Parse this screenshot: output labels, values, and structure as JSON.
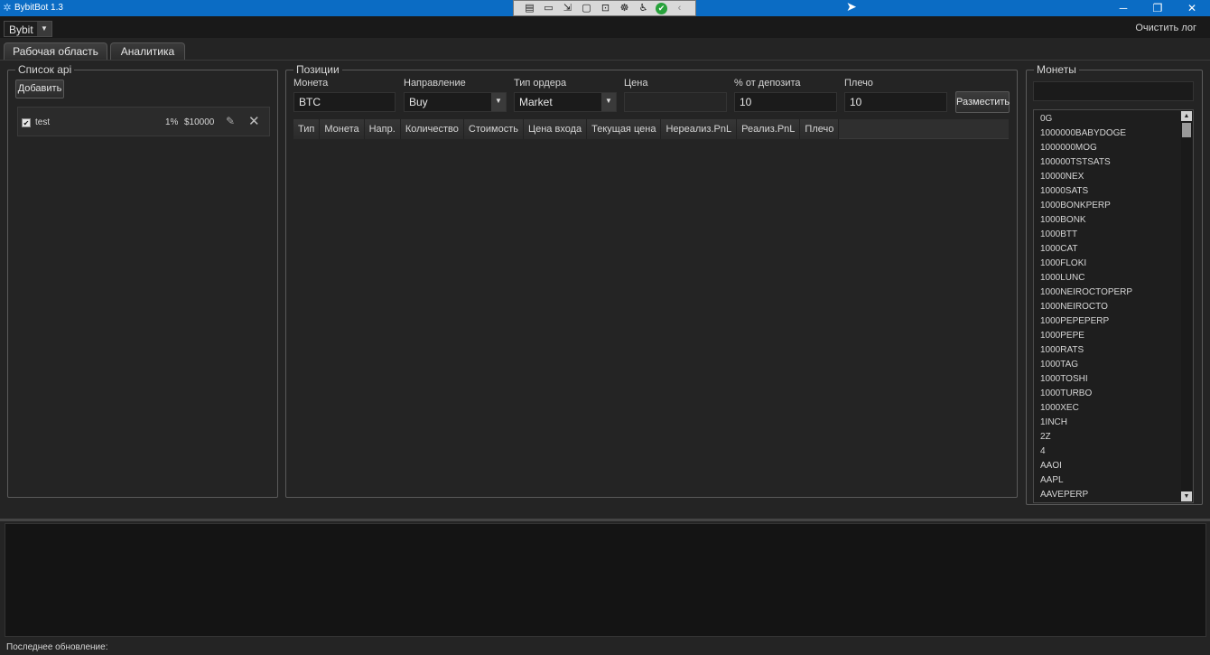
{
  "window": {
    "title": "BybitBot 1.3",
    "app_icon": "app-icon",
    "controls": {
      "minimize": "─",
      "maximize": "❐",
      "close": "✕"
    }
  },
  "recorder_toolbar": {
    "icons": [
      "select-icon",
      "video-icon",
      "pointer-icon",
      "frame-icon",
      "window-icon",
      "gamepad-icon",
      "accessibility-icon",
      "check-icon",
      "collapse-icon"
    ],
    "glyphs": [
      "▤",
      "▭",
      "⇲",
      "▢",
      "⊡",
      "☸",
      "♿",
      "✔",
      "‹"
    ]
  },
  "menubar": {
    "exchange": "Bybit",
    "clear_log": "Очистить лог"
  },
  "tabs": [
    {
      "label": "Рабочая область"
    },
    {
      "label": "Аналитика"
    }
  ],
  "api_panel": {
    "title": "Список api",
    "add_button": "Добавить",
    "items": [
      {
        "name": "test",
        "percent": "1%",
        "balance": "$10000",
        "checked": true
      }
    ]
  },
  "positions_panel": {
    "title": "Позиции",
    "fields": {
      "coin": {
        "label": "Монета",
        "value": "BTC"
      },
      "direction": {
        "label": "Направление",
        "value": "Buy"
      },
      "order_type": {
        "label": "Тип ордера",
        "value": "Market"
      },
      "price": {
        "label": "Цена",
        "value": ""
      },
      "deposit_pct": {
        "label": "% от депозита",
        "value": "10"
      },
      "leverage": {
        "label": "Плечо",
        "value": "10"
      }
    },
    "place_button": "Разместить",
    "columns": [
      "Тип",
      "Монета",
      "Напр.",
      "Количество",
      "Стоимость",
      "Цена входа",
      "Текущая цена",
      "Нереализ.PnL",
      "Реализ.PnL",
      "Плечо"
    ]
  },
  "coins_panel": {
    "title": "Монеты",
    "search_value": "",
    "items": [
      "0G",
      "1000000BABYDOGE",
      "1000000MOG",
      "100000TSTSATS",
      "10000NEX",
      "10000SATS",
      "1000BONKPERP",
      "1000BONK",
      "1000BTT",
      "1000CAT",
      "1000FLOKI",
      "1000LUNC",
      "1000NEIROCTOPERP",
      "1000NEIROCTO",
      "1000PEPEPERP",
      "1000PEPE",
      "1000RATS",
      "1000TAG",
      "1000TOSHI",
      "1000TURBO",
      "1000XEC",
      "1INCH",
      "2Z",
      "4",
      "AAOI",
      "AAPL",
      "AAVEPERP"
    ]
  },
  "status_bar": {
    "last_update_label": "Последнее обновление:"
  }
}
